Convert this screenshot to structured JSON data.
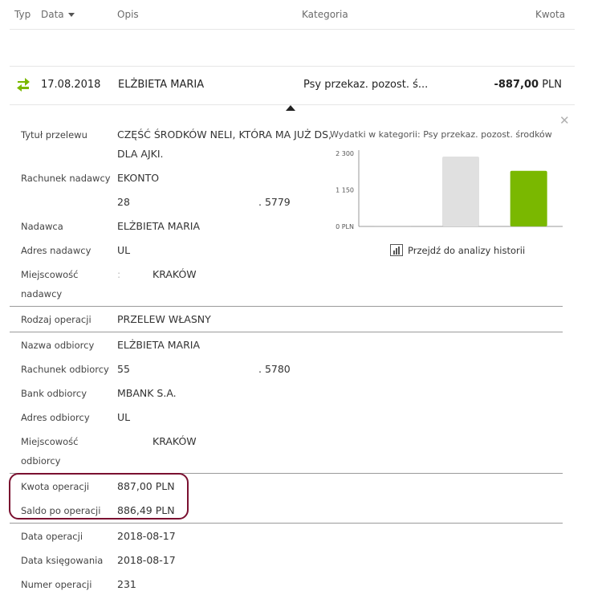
{
  "header": {
    "col_type": "Typ",
    "col_date": "Data",
    "col_desc": "Opis",
    "col_category": "Kategoria",
    "col_amount": "Kwota"
  },
  "transaction": {
    "date": "17.08.2018",
    "description": "ELŻBIETA MARIA",
    "category": "Psy przekaz. pozost. ś...",
    "amount": "-887,00",
    "currency": "PLN"
  },
  "details": {
    "title_label": "Tytuł przelewu",
    "title_line1": "CZĘŚĆ ŚRODKÓW NELI, KTÓRA MA JUŻ DS,",
    "title_line2": "DLA AJKI.",
    "sender_account_label": "Rachunek nadawcy",
    "sender_account_name": "EKONTO",
    "sender_account_start": "28",
    "sender_account_end": ". 5779",
    "sender_label": "Nadawca",
    "sender_value": "ELŻBIETA MARIA",
    "sender_address_label": "Adres nadawcy",
    "sender_address_value": "UL",
    "sender_city_label_1": "Miejscowość",
    "sender_city_label_2": "nadawcy",
    "sender_city_mark": ":",
    "sender_city_value": "KRAKÓW",
    "operation_type_label": "Rodzaj operacji",
    "operation_type_value": "PRZELEW WŁASNY",
    "recipient_label": "Nazwa odbiorcy",
    "recipient_value": "ELŻBIETA MARIA",
    "recipient_account_label": "Rachunek odbiorcy",
    "recipient_account_start": "55",
    "recipient_account_end": ". 5780",
    "recipient_bank_label": "Bank odbiorcy",
    "recipient_bank_value": "MBANK S.A.",
    "recipient_address_label": "Adres odbiorcy",
    "recipient_address_value": "UL",
    "recipient_city_label_1": "Miejscowość",
    "recipient_city_label_2": "odbiorcy",
    "recipient_city_value": "KRAKÓW",
    "op_amount_label": "Kwota operacji",
    "op_amount_value": "887,00 PLN",
    "balance_label": "Saldo po operacji",
    "balance_value": "886,49 PLN",
    "op_date_label": "Data operacji",
    "op_date_value": "2018-08-17",
    "booking_date_label": "Data księgowania",
    "booking_date_value": "2018-08-17",
    "op_number_label": "Numer operacji",
    "op_number_value": "231"
  },
  "chart_panel": {
    "title": "Wydatki w kategorii:  Psy przekaz. pozost. środków",
    "history_link": "Przejdź do analizy historii"
  },
  "colors": {
    "accent_green": "#7ab800",
    "bar_grey": "#e0e0e0",
    "highlight": "#7a1030"
  },
  "chart_data": {
    "type": "bar",
    "tick_labels": [
      "0 PLN",
      "1 150",
      "2 300"
    ],
    "ylim": [
      0,
      2300
    ],
    "values": [
      0,
      2200,
      1750
    ],
    "bar_colors": [
      "#e0e0e0",
      "#e0e0e0",
      "#7ab800"
    ]
  }
}
